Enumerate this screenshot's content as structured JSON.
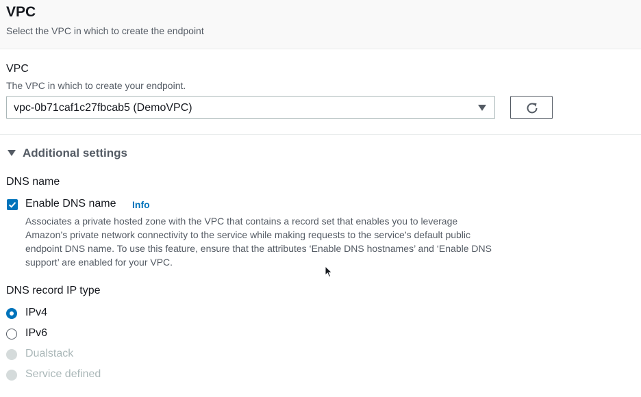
{
  "vpc_section": {
    "title": "VPC",
    "description": "Select the VPC in which to create the endpoint"
  },
  "vpc_field": {
    "label": "VPC",
    "description": "The VPC in which to create your endpoint.",
    "selected": "vpc-0b71caf1c27fbcab5 (DemoVPC)",
    "caret_icon": "caret-down-icon",
    "refresh_icon": "refresh-icon"
  },
  "additional_settings": {
    "label": "Additional settings",
    "expanded": true
  },
  "dns_name": {
    "label": "DNS name",
    "checkbox_label": "Enable DNS name",
    "checked": true,
    "info": "Info",
    "description": "Associates a private hosted zone with the VPC that contains a record set that enables you to leverage Amazon’s private network connectivity to the service while making requests to the service’s default public endpoint DNS name. To use this feature, ensure that the attributes ‘Enable DNS hostnames’ and ‘Enable DNS support’ are enabled for your VPC."
  },
  "dns_record_ip_type": {
    "label": "DNS record IP type",
    "options": [
      {
        "label": "IPv4",
        "selected": true,
        "disabled": false
      },
      {
        "label": "IPv6",
        "selected": false,
        "disabled": false
      },
      {
        "label": "Dualstack",
        "selected": false,
        "disabled": true
      },
      {
        "label": "Service defined",
        "selected": false,
        "disabled": true
      }
    ]
  },
  "colors": {
    "accent": "#0073bb",
    "text": "#16191f",
    "muted": "#545b64",
    "disabled": "#aab7b8"
  }
}
